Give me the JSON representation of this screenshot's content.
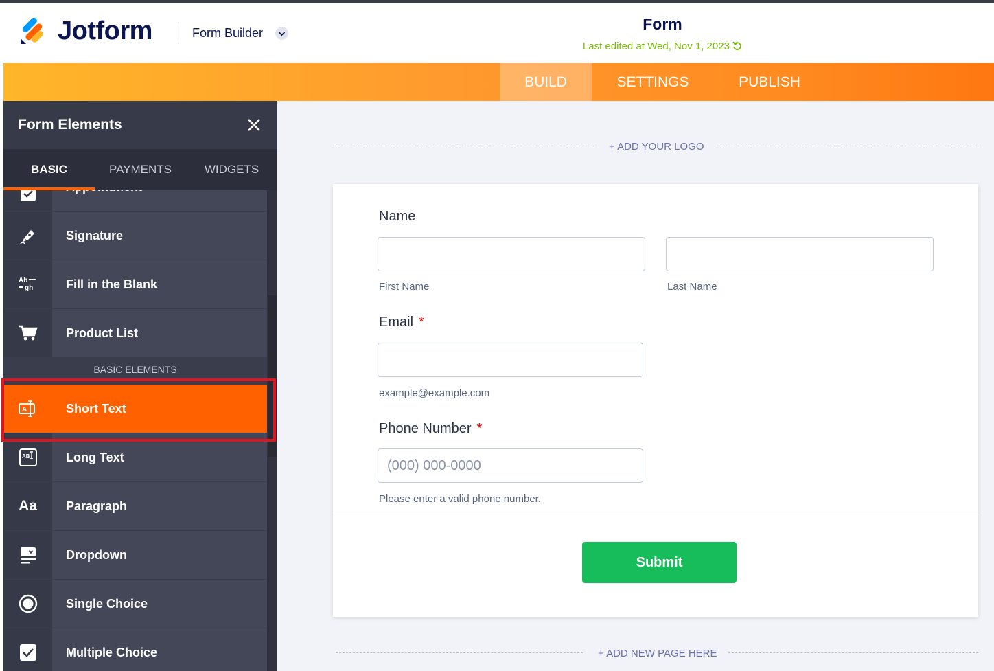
{
  "header": {
    "brand": "Jotform",
    "builder_label": "Form Builder",
    "form_title": "Form",
    "last_edited": "Last edited at Wed, Nov 1, 2023"
  },
  "tabs": [
    {
      "label": "BUILD",
      "active": true
    },
    {
      "label": "SETTINGS",
      "active": false
    },
    {
      "label": "PUBLISH",
      "active": false
    }
  ],
  "sidebar": {
    "title": "Form Elements",
    "tabs": [
      {
        "label": "BASIC",
        "active": true
      },
      {
        "label": "PAYMENTS",
        "active": false
      },
      {
        "label": "WIDGETS",
        "active": false
      }
    ],
    "items_top": [
      {
        "label": "Appointment",
        "icon": "calendar-check-icon"
      },
      {
        "label": "Signature",
        "icon": "pen-icon"
      },
      {
        "label": "Fill in the Blank",
        "icon": "fill-blank-icon"
      },
      {
        "label": "Product List",
        "icon": "cart-icon"
      }
    ],
    "section_label": "BASIC ELEMENTS",
    "items_basic": [
      {
        "label": "Short Text",
        "icon": "short-text-icon",
        "selected": true
      },
      {
        "label": "Long Text",
        "icon": "long-text-icon"
      },
      {
        "label": "Paragraph",
        "icon": "paragraph-icon",
        "glyph": "Aa"
      },
      {
        "label": "Dropdown",
        "icon": "dropdown-icon"
      },
      {
        "label": "Single Choice",
        "icon": "radio-icon"
      },
      {
        "label": "Multiple Choice",
        "icon": "checkbox-icon"
      }
    ]
  },
  "canvas": {
    "add_logo": "+ ADD YOUR LOGO",
    "add_page": "+ ADD NEW PAGE HERE",
    "name_label": "Name",
    "first_name_sub": "First Name",
    "last_name_sub": "Last Name",
    "email_label": "Email",
    "email_sub": "example@example.com",
    "phone_label": "Phone Number",
    "phone_placeholder": "(000) 000-0000",
    "phone_sub": "Please enter a valid phone number.",
    "required_mark": "*",
    "submit_label": "Submit"
  },
  "colors": {
    "accent": "#ff6100",
    "brand_navy": "#0a1551",
    "submit_green": "#18bd5b",
    "edited_green": "#78bb07"
  }
}
